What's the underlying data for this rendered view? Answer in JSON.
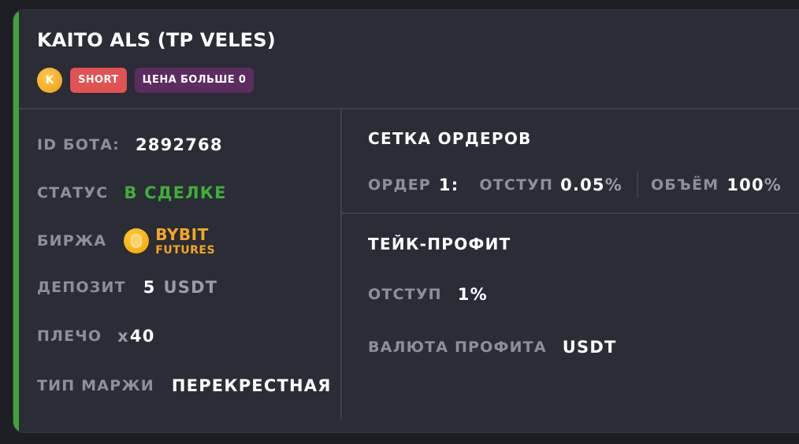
{
  "bot": {
    "title": "KAITO ALS (TP VELES)",
    "coin_letter": "K",
    "side_badge": "SHORT",
    "condition_badge": "ЦЕНА БОЛЬШЕ 0"
  },
  "info": {
    "id_label": "ID БОТА:",
    "id_value": "2892768",
    "status_label": "СТАТУС",
    "status_value": "В СДЕЛКЕ",
    "exchange_label": "БИРЖА",
    "exchange_name": "BYBIT",
    "exchange_type": "FUTURES",
    "deposit_label": "ДЕПОЗИТ",
    "deposit_amount": "5",
    "deposit_currency": "USDT",
    "leverage_label": "ПЛЕЧО",
    "leverage_prefix": "x",
    "leverage_value": "40",
    "margin_label": "ТИП МАРЖИ",
    "margin_value": "ПЕРЕКРЕСТНАЯ"
  },
  "grid": {
    "title": "СЕТКА ОРДЕРОВ",
    "order_label": "ОРДЕР",
    "order_num": "1:",
    "offset_label": "ОТСТУП",
    "offset_value": "0.05",
    "offset_unit": "%",
    "volume_label": "ОБЪЁМ",
    "volume_value": "100",
    "volume_unit": "%"
  },
  "tp": {
    "title": "ТЕЙК-ПРОФИТ",
    "offset_label": "ОТСТУП",
    "offset_value": "1%",
    "currency_label": "ВАЛЮТА ПРОФИТА",
    "currency_value": "USDT"
  },
  "colors": {
    "accent_green": "#3fa535",
    "short_red": "#e25252",
    "condition_purple": "#5b2d5e",
    "bybit_orange": "#f5a623"
  },
  "icons": {
    "coin": "kaito-coin-icon",
    "exchange": "bybit-logo-icon"
  }
}
